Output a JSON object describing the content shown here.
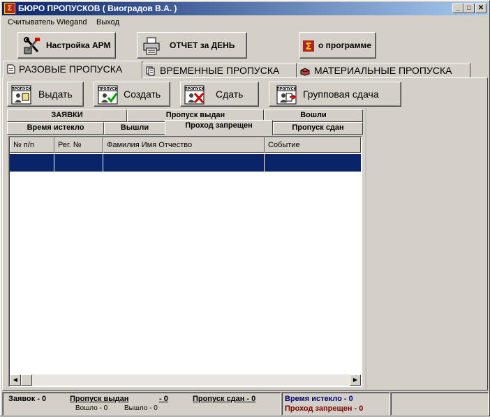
{
  "window": {
    "title": "БЮРО ПРОПУСКОВ  ( Виоградов В.А. )",
    "icon_glyph": "Σ",
    "min_glyph": "_",
    "max_glyph": "□",
    "close_glyph": "✕"
  },
  "menu": {
    "items": [
      "Считыватель Wiegand",
      "Выход"
    ]
  },
  "toolbar": {
    "settings_label": "Настройка АРМ",
    "report_label": "ОТЧЕТ за ДЕНЬ",
    "about_label": "о программе"
  },
  "main_tabs": [
    {
      "label": "РАЗОВЫЕ ПРОПУСКА",
      "active": true
    },
    {
      "label": "ВРЕМЕННЫЕ ПРОПУСКА",
      "active": false
    },
    {
      "label": "МАТЕРИАЛЬНЫЕ ПРОПУСКА",
      "active": false
    }
  ],
  "actions": {
    "issue_label": "Выдать",
    "create_label": "Создать",
    "return_label": "Сдать",
    "group_return_label": "Групповая сдача",
    "icon_text": "ПРОПУСК"
  },
  "sub_tabs": {
    "row1": [
      "ЗАЯВКИ",
      "Пропуск выдан",
      "Вошли"
    ],
    "row2": [
      "Время истекло",
      "Вышли",
      "Проход запрещен",
      "Пропуск сдан"
    ],
    "active": "Проход запрещен"
  },
  "table": {
    "columns": [
      "№ п/п",
      "Рег. №",
      "Фамилия Имя Отчество",
      "Событие"
    ],
    "rows": [],
    "selection_color": "#0a246a"
  },
  "status": {
    "requests": "Заявок - 0",
    "pass_issued": "Пропуск выдан",
    "pass_issued_count": "- 0",
    "entered": "Вошло - 0",
    "exited": "Вышло - 0",
    "pass_returned": "Пропуск сдан - 0",
    "time_expired": "Время истекло - 0",
    "access_denied": "Проход запрещен - 0",
    "time_expired_color": "#000080",
    "access_denied_color": "#800000"
  }
}
